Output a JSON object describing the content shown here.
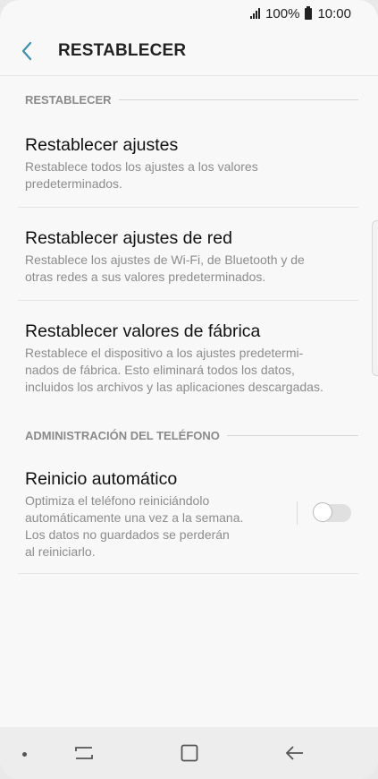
{
  "status": {
    "battery": "100%",
    "time": "10:00"
  },
  "header": {
    "title": "RESTABLECER"
  },
  "sections": [
    {
      "header": "RESTABLECER"
    },
    {
      "header": "ADMINISTRACIÓN DEL TELÉFONO"
    }
  ],
  "items": [
    {
      "title": "Restablecer ajustes",
      "sub1": "Restablece todos los ajustes a los valores",
      "sub2": "predeterminados."
    },
    {
      "title": "Restablecer ajustes de red",
      "sub1": "Restablece los ajustes de Wi-Fi, de Bluetooth y de",
      "sub2": "otras redes a sus valores predeterminados."
    },
    {
      "title": "Restablecer valores de fábrica",
      "sub1": "Restablece el dispositivo a los ajustes predetermi-",
      "sub2": "nados de fábrica. Esto eliminará todos los datos,",
      "sub3": "incluidos los archivos y las aplicaciones descargadas."
    },
    {
      "title": "Reinicio automático",
      "sub1": "Optimiza el teléfono reiniciándolo",
      "sub2": "automáticamente una vez a la semana.",
      "sub3": "Los datos no guardados se perderán",
      "sub4": "al reiniciarlo.",
      "toggle_on": false
    }
  ],
  "icons": {
    "back": "back-arrow-icon",
    "recent": "recent-apps-icon",
    "home": "home-icon",
    "back_nav": "back-nav-icon"
  },
  "colors": {
    "accent": "#3d8fb0",
    "background": "#f8f8f8"
  }
}
